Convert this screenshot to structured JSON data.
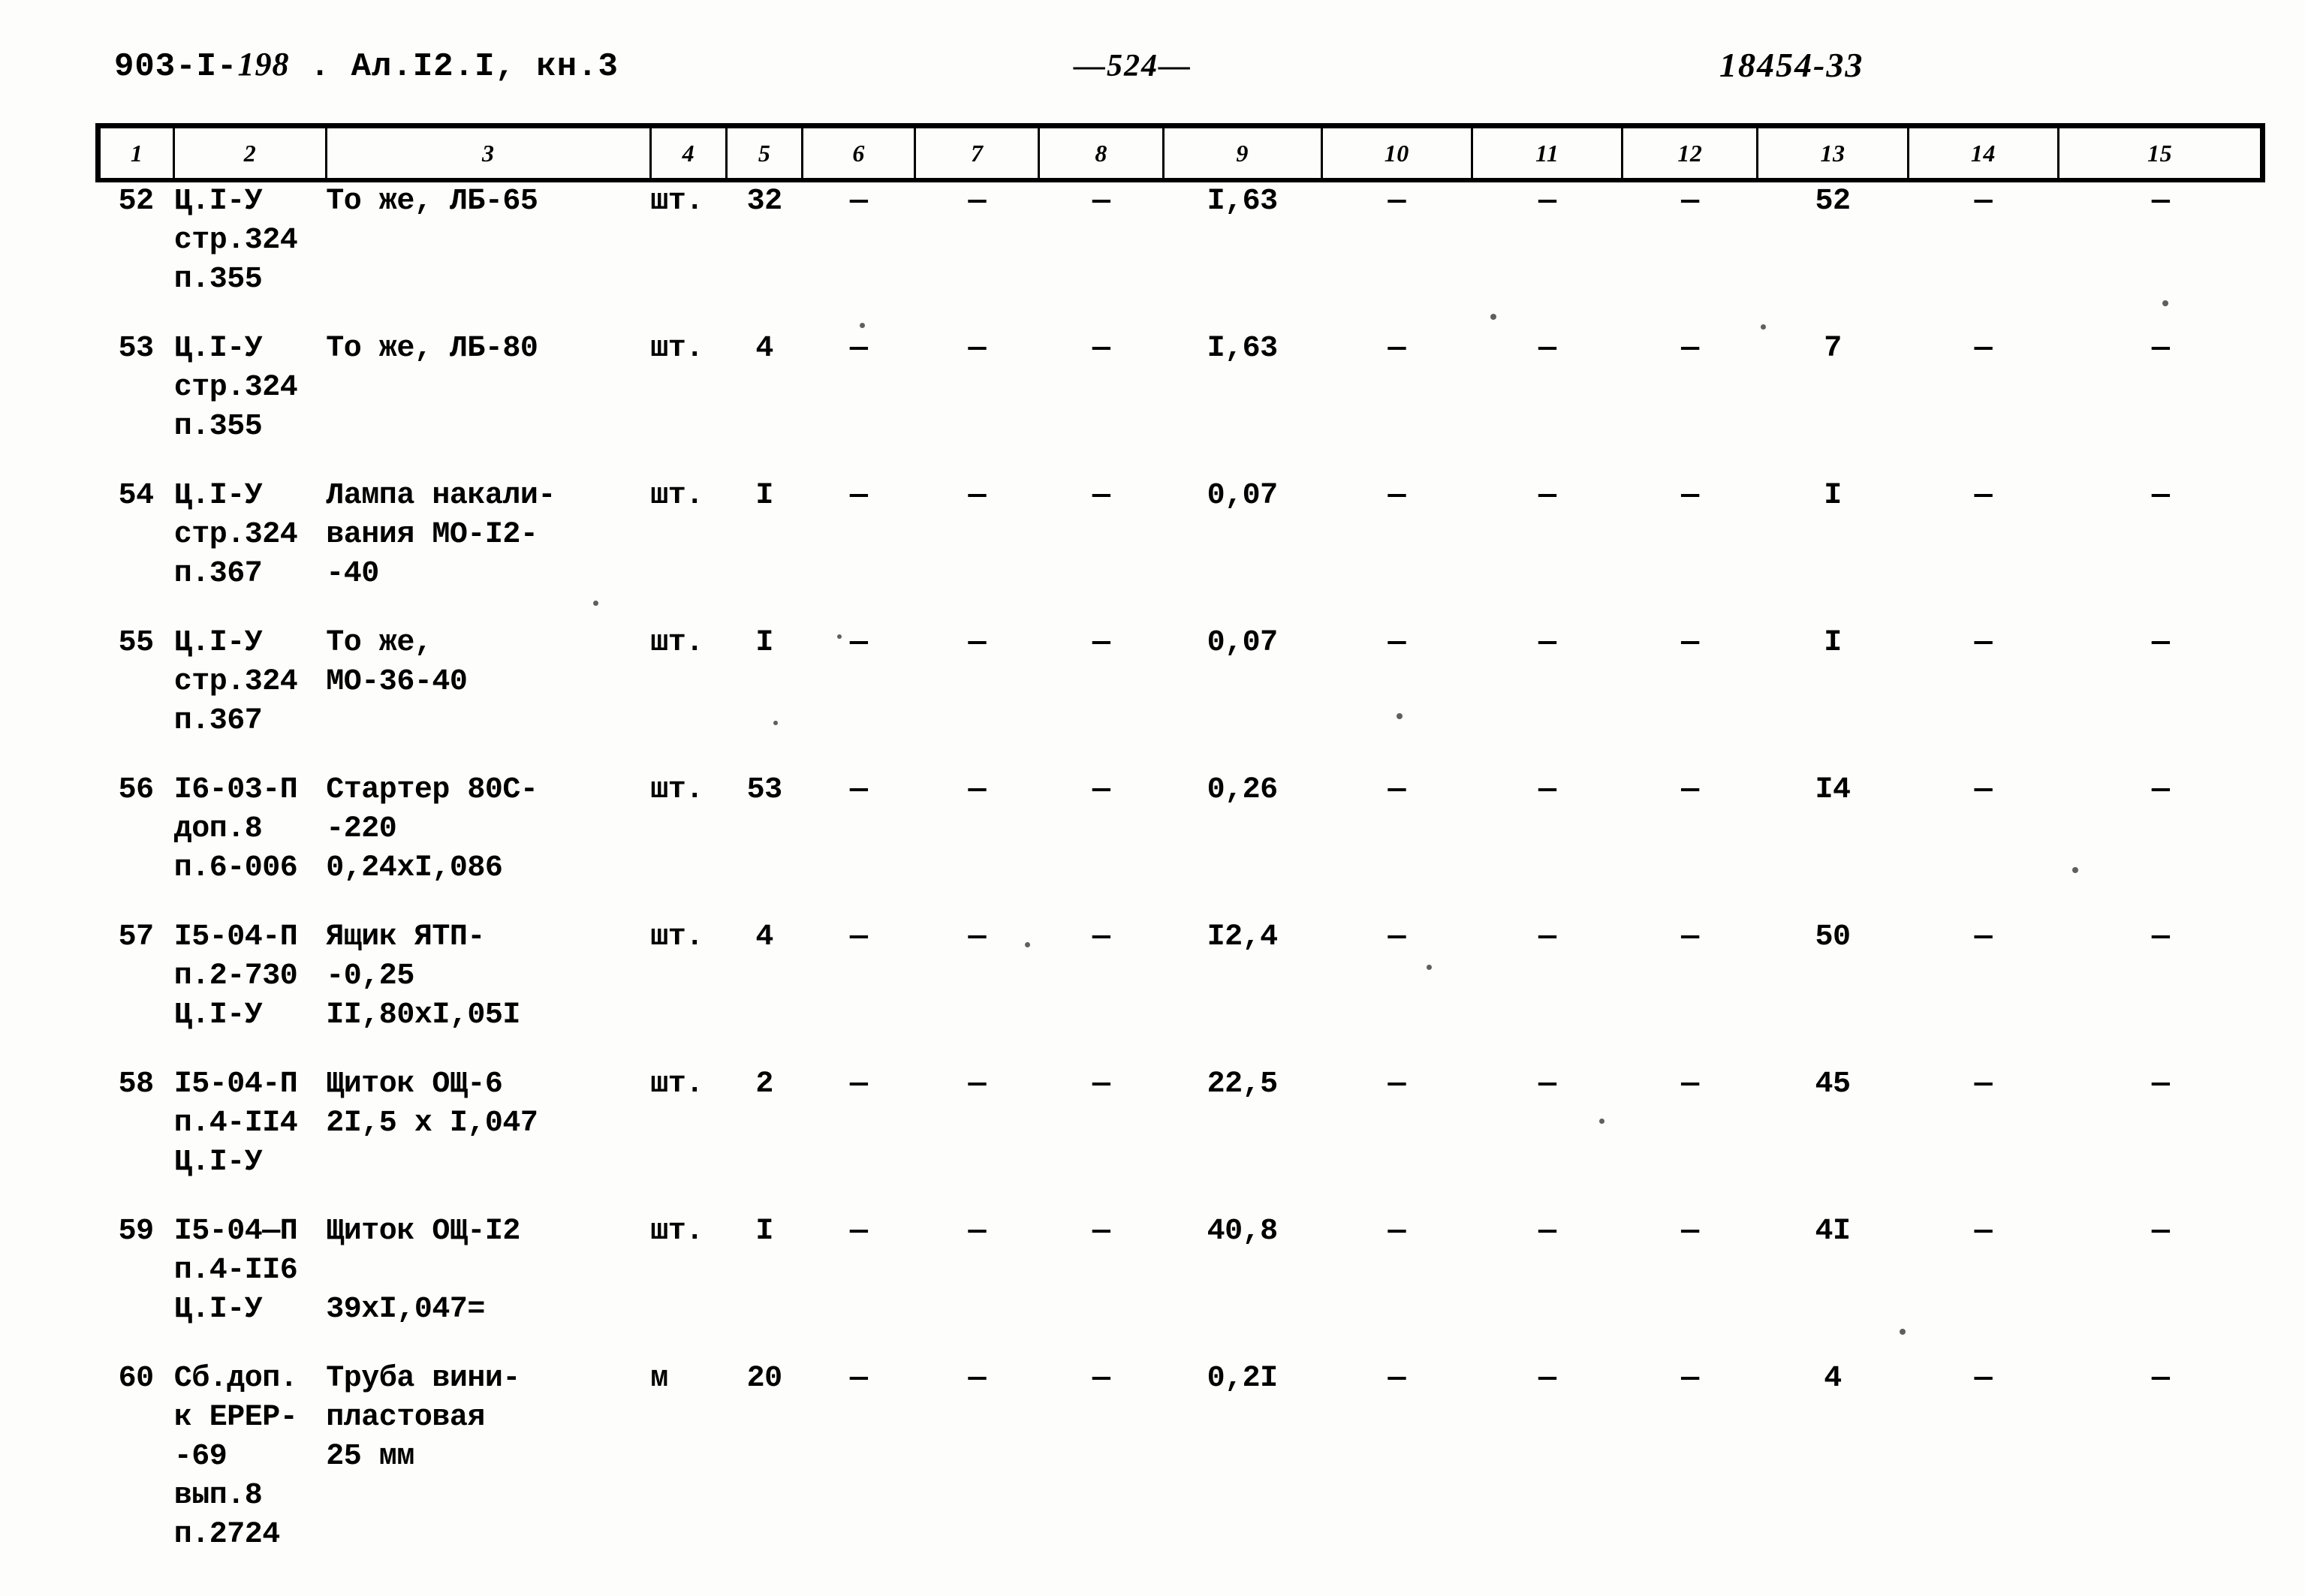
{
  "header": {
    "doc_code_printed": "903-I-",
    "doc_code_hand": "198",
    "doc_code_rest": " . Ал.I2.I, кн.3",
    "page_number": "—524—",
    "archive_number": "18454-33"
  },
  "table": {
    "column_headers": [
      "1",
      "2",
      "3",
      "4",
      "5",
      "6",
      "7",
      "8",
      "9",
      "10",
      "11",
      "12",
      "13",
      "14",
      "15"
    ],
    "dash": "—",
    "rows": [
      {
        "num": "52",
        "code": "Ц.I-У\nстр.324\nп.355",
        "name": "То же, ЛБ-65",
        "unit": "шт.",
        "qty": "32",
        "c6": "—",
        "c7": "—",
        "c8": "—",
        "c9": "I,63",
        "c10": "—",
        "c11": "—",
        "c12": "—",
        "c13": "52",
        "c14": "—",
        "c15": "—",
        "align": 1
      },
      {
        "num": "53",
        "code": "Ц.I-У\nстр.324\nп.355",
        "name": "То же, ЛБ-80",
        "unit": "шт.",
        "qty": "4",
        "c6": "—",
        "c7": "—",
        "c8": "—",
        "c9": "I,63",
        "c10": "—",
        "c11": "—",
        "c12": "—",
        "c13": "7",
        "c14": "—",
        "c15": "—",
        "align": 1
      },
      {
        "num": "54",
        "code": "Ц.I-У\nстр.324\nп.367",
        "name": "Лампа накали-\nвания МО-I2-\n-40",
        "unit": "шт.",
        "qty": "I",
        "c6": "—",
        "c7": "—",
        "c8": "—",
        "c9": "0,07",
        "c10": "—",
        "c11": "—",
        "c12": "—",
        "c13": "I",
        "c14": "—",
        "c15": "—",
        "align": 3
      },
      {
        "num": "55",
        "code": "Ц.I-У\nстр.324\nп.367",
        "name": "То же,\nМО-36-40",
        "unit": "шт.",
        "qty": "I",
        "c6": "—",
        "c7": "—",
        "c8": "—",
        "c9": "0,07",
        "c10": "—",
        "c11": "—",
        "c12": "—",
        "c13": "I",
        "c14": "—",
        "c15": "—",
        "align": 1
      },
      {
        "num": "56",
        "code": "I6-03-П\nдоп.8\nп.6-006",
        "name": "Стартер 80С-\n-220\n0,24хI,086",
        "unit": "шт.",
        "qty": "53",
        "c6": "—",
        "c7": "—",
        "c8": "—",
        "c9": "0,26",
        "c10": "—",
        "c11": "—",
        "c12": "—",
        "c13": "I4",
        "c14": "—",
        "c15": "—",
        "align": 2
      },
      {
        "num": "57",
        "code": "I5-04-П\nп.2-730\nЦ.I-У",
        "name": "Ящик ЯТП-\n-0,25\nII,80хI,05I",
        "unit": "шт.",
        "qty": "4",
        "c6": "—",
        "c7": "—",
        "c8": "—",
        "c9": "I2,4",
        "c10": "—",
        "c11": "—",
        "c12": "—",
        "c13": "50",
        "c14": "—",
        "c15": "—",
        "align": 2
      },
      {
        "num": "58",
        "code": "I5-04-П\nп.4-II4\nЦ.I-У",
        "name": "Щиток ОЩ-6\n2I,5 х I,047",
        "unit": "шт.",
        "qty": "2",
        "c6": "—",
        "c7": "—",
        "c8": "—",
        "c9": "22,5",
        "c10": "—",
        "c11": "—",
        "c12": "—",
        "c13": "45",
        "c14": "—",
        "c15": "—",
        "align": 1
      },
      {
        "num": "59",
        "code": "I5-04—П\nп.4-II6\nЦ.I-У",
        "name": "Щиток ОЩ-I2\n\n39хI,047=",
        "unit": "шт.",
        "qty": "I",
        "c6": "—",
        "c7": "—",
        "c8": "—",
        "c9": "40,8",
        "c10": "—",
        "c11": "—",
        "c12": "—",
        "c13": "4I",
        "c14": "—",
        "c15": "—",
        "align": 1
      },
      {
        "num": "60",
        "code": "Сб.доп.\nк ЕРЕР-\n-69\nвып.8\nп.2724",
        "name": "Труба вини-\nпластовая\n25 мм",
        "unit": "м",
        "qty": "20",
        "c6": "—",
        "c7": "—",
        "c8": "—",
        "c9": "0,2I",
        "c10": "—",
        "c11": "—",
        "c12": "—",
        "c13": "4",
        "c14": "—",
        "c15": "—",
        "align": 2
      }
    ]
  }
}
